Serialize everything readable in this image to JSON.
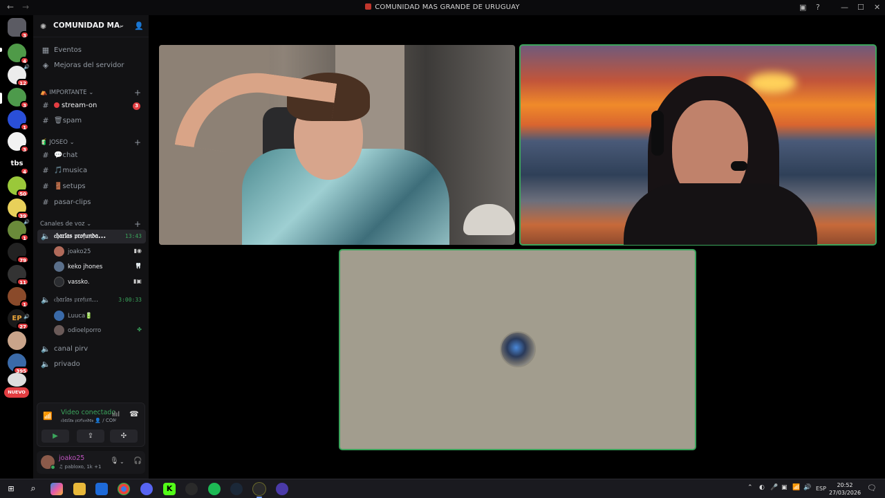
{
  "window": {
    "title": "COMUNIDAD MAS GRANDE DE URUGUAY",
    "back": "←",
    "forward": "→",
    "controls": [
      "▣",
      "?",
      "—",
      "☐",
      "✕"
    ]
  },
  "servers": [
    {
      "badge": "3",
      "color": "#5b5b63"
    },
    {
      "badge": "4",
      "color": "#4f9a48"
    },
    {
      "badge": "12",
      "color": "#ececec"
    },
    {
      "badge": "3",
      "color": "#4d9a4b"
    },
    {
      "badge": "1",
      "color": "#2a4fd8"
    },
    {
      "badge": "3",
      "color": "#f2f2f2"
    },
    {
      "badge": "4",
      "label": "tbs",
      "color": "#000000"
    },
    {
      "badge": "50",
      "color": "#9ac83a"
    },
    {
      "badge": "39",
      "color": "#e8d05a"
    },
    {
      "badge": "1",
      "color": "#6a8a3a"
    },
    {
      "badge": "79",
      "color": "#222222"
    },
    {
      "badge": "11",
      "color": "#333333"
    },
    {
      "badge": "1",
      "color": "#8a4a2a"
    },
    {
      "badge": "27",
      "label": "EP",
      "color": "#1a1a1a"
    },
    {
      "badge": "",
      "color": "#c9a48a"
    },
    {
      "badge": "395",
      "color": "#3a6aa8"
    },
    {
      "badge": "",
      "color": "#dddddd"
    }
  ],
  "servers_new_label": "NUEVO",
  "guild": {
    "name": "COMUNIDAD MA...",
    "icon": "server-icon",
    "chevron": "⌄",
    "invite_icon": "add-member-icon"
  },
  "nav": {
    "events": "Eventos",
    "boosts": "Mejoras del servidor"
  },
  "categories": {
    "importante": "IMPORTANTE",
    "joseo": "JOSEO",
    "voice": "Canales de voz"
  },
  "channels": {
    "stream_on": {
      "label": "stream-on",
      "badge": "3"
    },
    "spam": {
      "label": "spam"
    },
    "chat": {
      "label": "chat"
    },
    "musica": {
      "label": "musica"
    },
    "setups": {
      "label": "setups"
    },
    "pasar_clips": {
      "label": "pasar-clips"
    }
  },
  "voice_channels": {
    "charlas_1": {
      "label": "𝔠𝔥𝔞𝔯𝔩𝔞𝔰 𝔭𝔯𝔬𝔣𝔲𝔫𝔡𝔞...",
      "timer": "13:43"
    },
    "charlas_2": {
      "label": "𝔠𝔥𝔞𝔯𝔩𝔞𝔰 𝔭𝔯𝔬𝔣𝔲𝔫...",
      "timer": "3:00:33"
    },
    "canal_pirv": {
      "label": "canal pirv"
    },
    "privado": {
      "label": "privado"
    }
  },
  "voice_users": {
    "joako25": {
      "name": "joako25",
      "status": "▮◉",
      "color": "#b06a5a"
    },
    "keko": {
      "name": "keko jhones",
      "status": "🦷",
      "color": "#5a6f8a"
    },
    "vassko": {
      "name": "vassko.",
      "status": "▮▣",
      "color": "#2b2d31"
    },
    "luuca": {
      "name": "Luuca🔋",
      "status": "",
      "color": "#3a6aa8"
    },
    "odioelporro": {
      "name": "odioelporro",
      "status": "✤",
      "color": "#6a5a58"
    }
  },
  "rtc": {
    "status": "Video conectado",
    "subtext": "𝔠𝔥𝔞𝔯𝔩𝔞𝔰 𝔭𝔯𝔬𝔣𝔲𝔫𝔡𝔞𝔰 👤 / COM...",
    "buttons": [
      "camera-icon",
      "screen-share-icon",
      "activities-icon",
      "soundboard-icon"
    ]
  },
  "user": {
    "name": "joako25",
    "activity": "♫ pabloxo, 1k +1"
  },
  "stage": {
    "tiles": [
      {
        "id": "tile-1",
        "speaking": false
      },
      {
        "id": "tile-2",
        "speaking": true
      },
      {
        "id": "tile-3",
        "speaking": true
      }
    ]
  },
  "taskbar": {
    "apps": [
      "start-icon",
      "search-icon",
      "copilot-icon",
      "file-explorer-icon",
      "store-icon",
      "chrome-icon",
      "discord-icon",
      "kick-icon",
      "obs-icon",
      "spotify-icon",
      "steam-icon",
      "app-icon",
      "app-icon"
    ],
    "lang": "ESP",
    "time": "20:52",
    "date": "27/03/2026"
  }
}
